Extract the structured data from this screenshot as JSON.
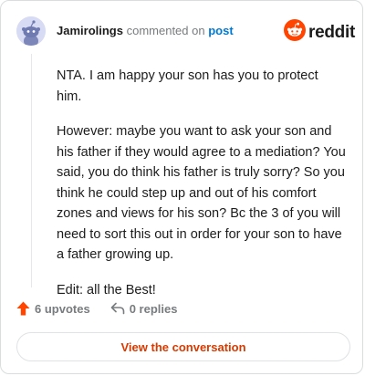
{
  "colors": {
    "accent": "#ff4500",
    "link": "#0079d3",
    "button_text": "#d93a00",
    "muted": "#787c7e"
  },
  "header": {
    "username": "Jamirolings",
    "action_text": "commented on",
    "post_link": "post",
    "logo_text": "reddit"
  },
  "comment": {
    "paragraphs": [
      "NTA. I am happy your son has you to protect him.",
      "However: maybe you want to ask your son and his father if they would agree to a mediation? You said, you do think his father is truly sorry? So you think he could step up and out of his comfort zones and views for his son? Bc the 3 of you will need to sort this out in order for your son to have a father growing up.",
      "Edit: all the Best!"
    ]
  },
  "actions": {
    "upvotes_label": "6 upvotes",
    "replies_label": "0 replies"
  },
  "footer": {
    "view_button_label": "View the conversation"
  },
  "icons": {
    "avatar": "snoo-avatar-icon",
    "logo": "reddit-logo-icon",
    "upvote": "upvote-arrow-icon",
    "reply": "reply-arrow-icon"
  }
}
